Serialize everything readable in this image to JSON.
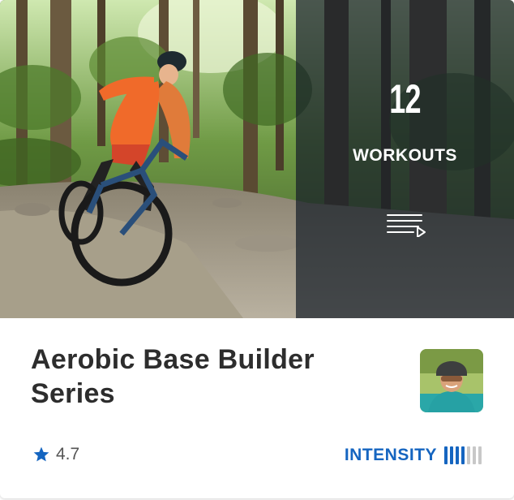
{
  "workouts": {
    "count": "12",
    "label": "WORKOUTS",
    "icon": "playlist-play-icon"
  },
  "series": {
    "title": "Aerobic Base Builder Series"
  },
  "rating": {
    "icon": "star-icon",
    "value": "4.7"
  },
  "intensity": {
    "label": "INTENSITY",
    "level": 4,
    "max": 7,
    "active_color": "#1565c0",
    "inactive_color": "#c8c8c8"
  },
  "colors": {
    "accent": "#1565c0",
    "overlay": "#161f28",
    "title_text": "#2d2d2d"
  }
}
